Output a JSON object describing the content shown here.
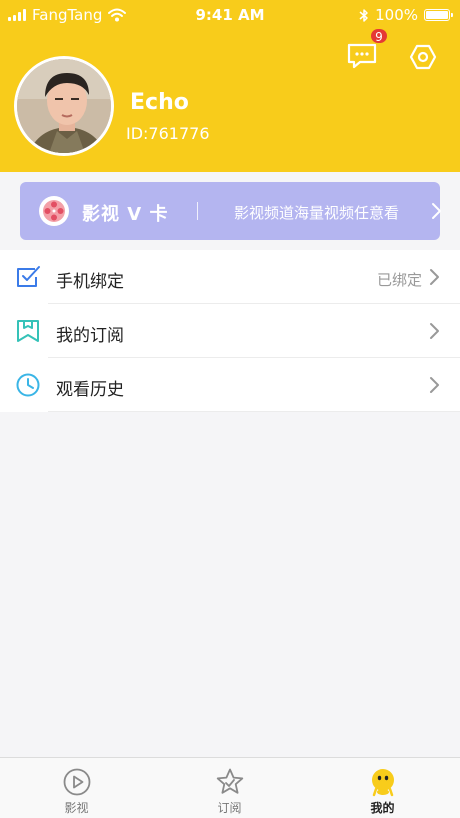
{
  "status_bar": {
    "carrier": "FangTang",
    "time": "9:41 AM",
    "battery": "100%"
  },
  "header": {
    "message_badge": "9",
    "username": "Echo",
    "user_id": "ID:761776"
  },
  "vcard": {
    "title": "影视 V 卡",
    "description": "影视频道海量视频任意看"
  },
  "menu": {
    "items": [
      {
        "label": "手机绑定",
        "status": "已绑定",
        "icon": "check-square-icon"
      },
      {
        "label": "我的订阅",
        "status": "",
        "icon": "bookmark-icon"
      },
      {
        "label": "观看历史",
        "status": "",
        "icon": "clock-icon"
      }
    ]
  },
  "tabbar": {
    "tabs": [
      {
        "label": "影视",
        "icon": "play-circle-icon",
        "active": false
      },
      {
        "label": "订阅",
        "icon": "star-icon",
        "active": false
      },
      {
        "label": "我的",
        "icon": "mascot-icon",
        "active": true
      }
    ]
  },
  "colors": {
    "header_bg": "#f8cc1b",
    "vcard_bg": "#b4b5f0",
    "badge": "#e53935",
    "icon_blue": "#3b7be8",
    "icon_teal": "#35c2b8",
    "icon_cyan": "#3ab5e6"
  }
}
